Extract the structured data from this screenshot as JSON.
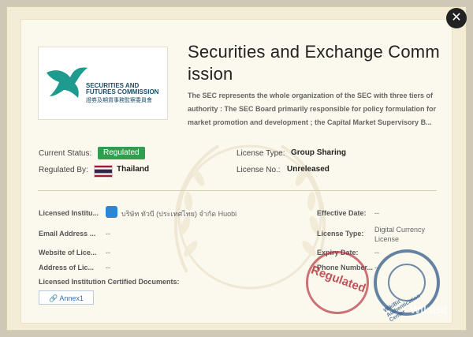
{
  "institution": {
    "logo_line1": "SECURITIES AND",
    "logo_line2": "FUTURES COMMISSION",
    "logo_line3": "證券及期貨事務監察委員會",
    "title": "Securities and Exchange Commission",
    "description": "The SEC represents the whole organization of the SEC with three tiers of authority : The SEC Board primarily responsible for policy formulation for market promotion and development ; the Capital Market Supervisory B..."
  },
  "status": {
    "current_status_label": "Current Status:",
    "current_status_value": "Regulated",
    "regulated_by_label": "Regulated By:",
    "regulated_by_value": "Thailand",
    "license_type_label": "License Type:",
    "license_type_value": "Group Sharing",
    "license_no_label": "License No.:",
    "license_no_value": "Unreleased"
  },
  "details": {
    "licensed_institution_label": "Licensed Institu...",
    "licensed_institution_value": "บริษัท ทัวบี (ประเทศไทย) จำกัด Huobi",
    "email_label": "Email Address ...",
    "email_value": "--",
    "website_label": "Website of Lice...",
    "website_value": "--",
    "address_label": "Address of Lic...",
    "address_value": "--",
    "documents_label": "Licensed Institution Certified Documents:",
    "effective_date_label": "Effective Date:",
    "effective_date_value": "--",
    "license_type_label": "License Type:",
    "license_type_value": "Digital Currency License",
    "expiry_date_label": "Expiry Date:",
    "expiry_date_value": "--",
    "phone_label": "Phone Number...",
    "phone_value": "--",
    "annex_label": "Annex1"
  },
  "stamps": {
    "red_text": "Regulated",
    "blue_text": "WikiBit Authentication Center"
  },
  "watermark": "WikiBit",
  "icons": {
    "close": "close-icon",
    "link": "link-icon",
    "huobi": "huobi-icon"
  },
  "colors": {
    "status_green": "#2f9e4f",
    "link_blue": "#3b6fb3",
    "stamp_red": "#b22834",
    "stamp_blue": "#325c8a"
  }
}
